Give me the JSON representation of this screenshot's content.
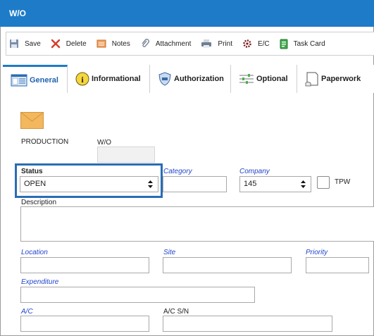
{
  "window": {
    "title": "W/O"
  },
  "toolbar": {
    "save": "Save",
    "delete": "Delete",
    "notes": "Notes",
    "attachment": "Attachment",
    "print": "Print",
    "ec": "E/C",
    "task_card": "Task Card"
  },
  "tabs": [
    {
      "label": "General",
      "icon": "general-form-icon",
      "active": true
    },
    {
      "label": "Informational",
      "icon": "info-icon"
    },
    {
      "label": "Authorization",
      "icon": "shield-icon"
    },
    {
      "label": "Optional",
      "icon": "sliders-icon"
    },
    {
      "label": "Paperwork",
      "icon": "paper-icon"
    }
  ],
  "form": {
    "production_label": "PRODUCTION",
    "wo_label": "W/O",
    "wo_value": "",
    "status_label": "Status",
    "status_value": "OPEN",
    "category_label": "Category",
    "category_value": "",
    "company_label": "Company",
    "company_value": "145",
    "tpw_label": "TPW",
    "description_label": "Description",
    "location_label": "Location",
    "site_label": "Site",
    "priority_label": "Priority",
    "expenditure_label": "Expenditure",
    "ac_label": "A/C",
    "ac_sn_label": "A/C S/N"
  },
  "colors": {
    "titlebar": "#1e7bc7",
    "highlight": "#2a6cb6",
    "required_label": "#2244cc"
  }
}
